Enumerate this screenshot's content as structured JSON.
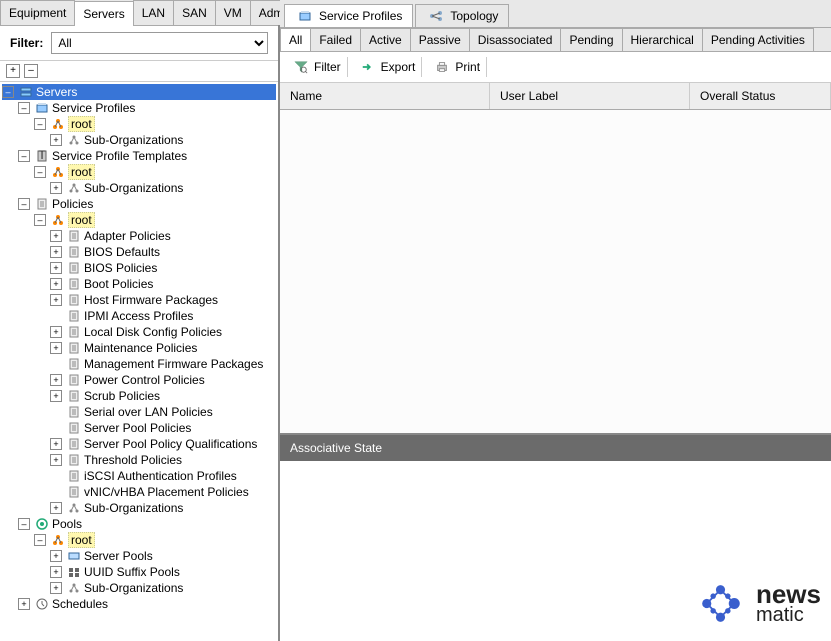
{
  "leftTabs": [
    "Equipment",
    "Servers",
    "LAN",
    "SAN",
    "VM",
    "Admin"
  ],
  "activeLeftTab": "Servers",
  "filter": {
    "label": "Filter:",
    "value": "All"
  },
  "treeToolbar": {
    "expand": "+",
    "collapse": "–"
  },
  "tree": [
    {
      "indent": 0,
      "expand": "minus",
      "label": "Servers",
      "select": true,
      "icon": "server-icon"
    },
    {
      "indent": 1,
      "expand": "minus",
      "label": "Service Profiles",
      "icon": "profiles-icon"
    },
    {
      "indent": 2,
      "expand": "minus",
      "label": "root",
      "icon": "root-icon",
      "highlight": true
    },
    {
      "indent": 3,
      "expand": "plus",
      "label": "Sub-Organizations",
      "icon": "org-icon"
    },
    {
      "indent": 1,
      "expand": "minus",
      "label": "Service Profile Templates",
      "icon": "template-icon"
    },
    {
      "indent": 2,
      "expand": "minus",
      "label": "root",
      "icon": "root-icon",
      "highlight": true
    },
    {
      "indent": 3,
      "expand": "plus",
      "label": "Sub-Organizations",
      "icon": "org-icon"
    },
    {
      "indent": 1,
      "expand": "minus",
      "label": "Policies",
      "icon": "policy-icon"
    },
    {
      "indent": 2,
      "expand": "minus",
      "label": "root",
      "icon": "root-icon",
      "highlight": true
    },
    {
      "indent": 3,
      "expand": "plus",
      "label": "Adapter Policies",
      "icon": "doc-icon"
    },
    {
      "indent": 3,
      "expand": "plus",
      "label": "BIOS Defaults",
      "icon": "doc-icon"
    },
    {
      "indent": 3,
      "expand": "plus",
      "label": "BIOS Policies",
      "icon": "doc-icon"
    },
    {
      "indent": 3,
      "expand": "plus",
      "label": "Boot Policies",
      "icon": "doc-icon"
    },
    {
      "indent": 3,
      "expand": "plus",
      "label": "Host Firmware Packages",
      "icon": "doc-icon"
    },
    {
      "indent": 3,
      "expand": "none",
      "label": "IPMI Access Profiles",
      "icon": "doc-icon"
    },
    {
      "indent": 3,
      "expand": "plus",
      "label": "Local Disk Config Policies",
      "icon": "doc-icon"
    },
    {
      "indent": 3,
      "expand": "plus",
      "label": "Maintenance Policies",
      "icon": "doc-icon"
    },
    {
      "indent": 3,
      "expand": "none",
      "label": "Management Firmware Packages",
      "icon": "doc-icon"
    },
    {
      "indent": 3,
      "expand": "plus",
      "label": "Power Control Policies",
      "icon": "doc-icon"
    },
    {
      "indent": 3,
      "expand": "plus",
      "label": "Scrub Policies",
      "icon": "doc-icon"
    },
    {
      "indent": 3,
      "expand": "none",
      "label": "Serial over LAN Policies",
      "icon": "doc-icon"
    },
    {
      "indent": 3,
      "expand": "none",
      "label": "Server Pool Policies",
      "icon": "doc-icon"
    },
    {
      "indent": 3,
      "expand": "plus",
      "label": "Server Pool Policy Qualifications",
      "icon": "doc-icon"
    },
    {
      "indent": 3,
      "expand": "plus",
      "label": "Threshold Policies",
      "icon": "doc-icon"
    },
    {
      "indent": 3,
      "expand": "none",
      "label": "iSCSI Authentication Profiles",
      "icon": "doc-icon"
    },
    {
      "indent": 3,
      "expand": "none",
      "label": "vNIC/vHBA Placement Policies",
      "icon": "doc-icon"
    },
    {
      "indent": 3,
      "expand": "plus",
      "label": "Sub-Organizations",
      "icon": "org-icon"
    },
    {
      "indent": 1,
      "expand": "minus",
      "label": "Pools",
      "icon": "pools-icon"
    },
    {
      "indent": 2,
      "expand": "minus",
      "label": "root",
      "icon": "root-icon",
      "highlight": true
    },
    {
      "indent": 3,
      "expand": "plus",
      "label": "Server Pools",
      "icon": "serverpool-icon"
    },
    {
      "indent": 3,
      "expand": "plus",
      "label": "UUID Suffix Pools",
      "icon": "uuid-icon"
    },
    {
      "indent": 3,
      "expand": "plus",
      "label": "Sub-Organizations",
      "icon": "org-icon"
    },
    {
      "indent": 1,
      "expand": "plus",
      "label": "Schedules",
      "icon": "schedule-icon"
    }
  ],
  "rightTabs": [
    {
      "label": "Service Profiles",
      "icon": "profiles-icon",
      "active": true
    },
    {
      "label": "Topology",
      "icon": "topology-icon",
      "active": false
    }
  ],
  "subTabs": [
    "All",
    "Failed",
    "Active",
    "Passive",
    "Disassociated",
    "Pending",
    "Hierarchical",
    "Pending Activities"
  ],
  "activeSubTab": "All",
  "actions": {
    "filter": "Filter",
    "export": "Export",
    "print": "Print"
  },
  "tableHeaders": {
    "name": "Name",
    "userLabel": "User Label",
    "overallStatus": "Overall Status"
  },
  "assocPanel": {
    "title": "Associative State"
  },
  "watermark": {
    "brand1": "news",
    "brand2": "matic"
  }
}
